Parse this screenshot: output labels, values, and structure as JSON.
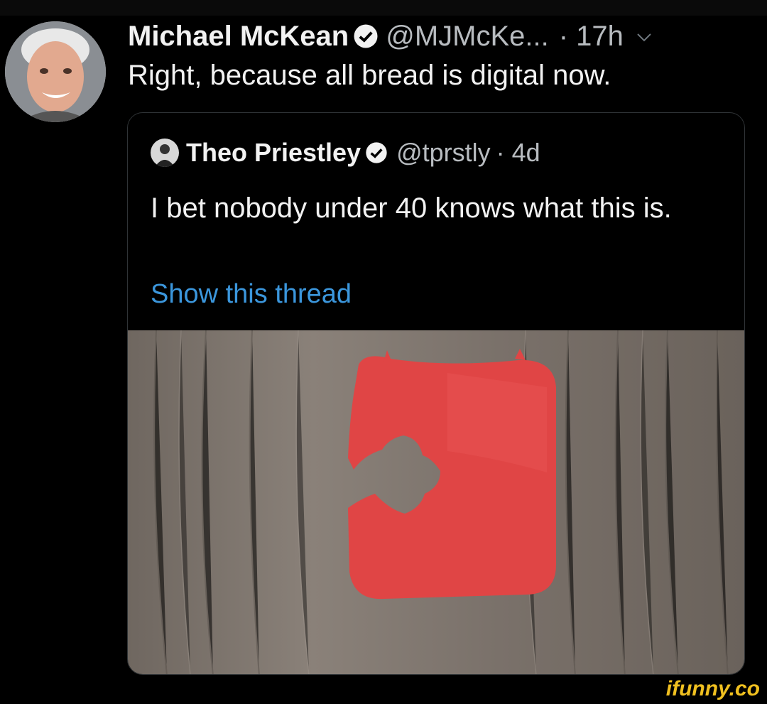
{
  "tweet": {
    "author_name": "Michael McKean",
    "author_handle": "@MJMcKe...",
    "time": "· 17h",
    "text": "Right, because all bread is digital now.",
    "avatar_icon": "person-avatar",
    "verified_icon": "verified-badge-icon",
    "menu_icon": "chevron-down-icon"
  },
  "quoted_tweet": {
    "author_name": "Theo Priestley",
    "author_handle": "@tprstly",
    "time": "· 4d",
    "text": "I bet nobody under 40 knows what this is.",
    "link_label": "Show this thread",
    "image_icon": "bread-bag-clip-photo"
  },
  "watermark": "ifunny.co",
  "colors": {
    "background": "#000000",
    "text": "#f2f2f2",
    "secondary_text": "#b8bcc0",
    "link": "#3b96dc",
    "clip_red": "#e04545",
    "watermark": "#f0c020"
  }
}
